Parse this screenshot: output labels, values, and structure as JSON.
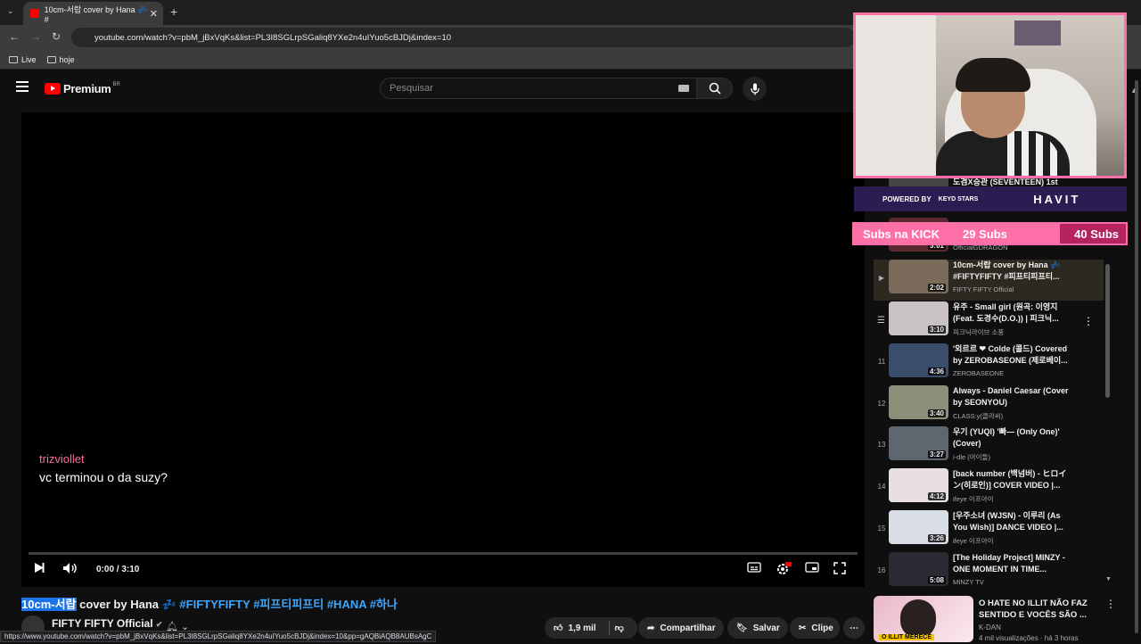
{
  "browser": {
    "tab_title": "10cm-서랍 cover by Hana 💤 #",
    "url": "youtube.com/watch?v=pbM_jBxVqKs&list=PL3I8SGLrpSGaliq8YXe2n4uIYuo5cBJDj&index=10",
    "bookmarks": [
      "Live",
      "hoje"
    ],
    "status_url": "https://www.youtube.com/watch?v=pbM_jBxVqKs&list=PL3I8SGLrpSGaliq8YXe2n4uIYuo5cBJDj&index=10&pp=gAQBiAQB8AUBsAgC"
  },
  "header": {
    "logo": "Premium",
    "region": "BR",
    "search_placeholder": "Pesquisar"
  },
  "player": {
    "time": "0:00 / 3:10",
    "chat_user": "trizviollet",
    "chat_message": "vc terminou o da suzy?"
  },
  "video": {
    "title_highlight": "10cm-서랍",
    "title_rest": " cover by Hana 💤 ",
    "title_tags": "#FIFTYFIFTY #피프티피프티 #HANA #하나",
    "channel": "FIFTY FIFTY Official",
    "likes": "1,9 mil",
    "share": "Compartilhar",
    "save": "Salvar",
    "clip": "Clipe"
  },
  "overlay": {
    "powered_by": "POWERED BY",
    "sponsor_small": "KEYD STARS",
    "sponsor": "HAVIT",
    "subs_label": "Subs na KICK",
    "subs_current": "29 Subs",
    "subs_goal": "40 Subs"
  },
  "playlist": [
    {
      "idx": "",
      "title": "도겸X승관 (SEVENTEEN) 1st",
      "channel": "",
      "duration": ""
    },
    {
      "idx": "",
      "title": "",
      "channel": "OfficialGDRAGON",
      "duration": "3:01"
    },
    {
      "idx": "▶",
      "title": "10cm-서랍 cover by Hana 💤 #FIFTYFIFTY #피프티피프티...",
      "channel": "FIFTY FIFTY Official",
      "duration": "2:02"
    },
    {
      "idx": "",
      "title": "유주 - Small girl (원곡: 이영지 (Feat. 도경수(D.O.)) | 피크닉...",
      "channel": "피크닉라이브 소풍",
      "duration": "3:10"
    },
    {
      "idx": "11",
      "title": "'외르르 ❤ Colde (콜드) Covered by ZEROBASEONE (제로베이...",
      "channel": "ZEROBASEONE",
      "duration": "4:36"
    },
    {
      "idx": "12",
      "title": "Always - Daniel Caesar (Cover by SEONYOU)",
      "channel": "CLASS:y(클라씨)",
      "duration": "3:40"
    },
    {
      "idx": "13",
      "title": "우기 (YUQI) '빠— (Only One)' (Cover)",
      "channel": "i-dle (아이들)",
      "duration": "3:27"
    },
    {
      "idx": "14",
      "title": "[back number (백넘버) - ヒロイン(히로인)] COVER VIDEO |...",
      "channel": "ifeye 이프아이",
      "duration": "4:12"
    },
    {
      "idx": "15",
      "title": "[우주소녀 (WJSN) - 이루리 (As You Wish)] DANCE VIDEO |...",
      "channel": "ifeye 이프아이",
      "duration": "3:26"
    },
    {
      "idx": "16",
      "title": "[The Holiday Project] MINZY - ONE MOMENT IN TIME...",
      "channel": "MINZY TV",
      "duration": "5:08"
    }
  ],
  "recommended": {
    "title": "O HATE NO ILLIT NÃO FAZ SENTIDO E VOCÊS SÃO ...",
    "channel": "K-DAN",
    "meta": "4 mil visualizações · há 3 horas",
    "thumb_text": "O ILLIT MERECE"
  },
  "colors": {
    "accent": "#ff6fa8",
    "yt_red": "#ff0000",
    "link": "#3ea6ff",
    "chat_user": "#ff6b9d"
  }
}
